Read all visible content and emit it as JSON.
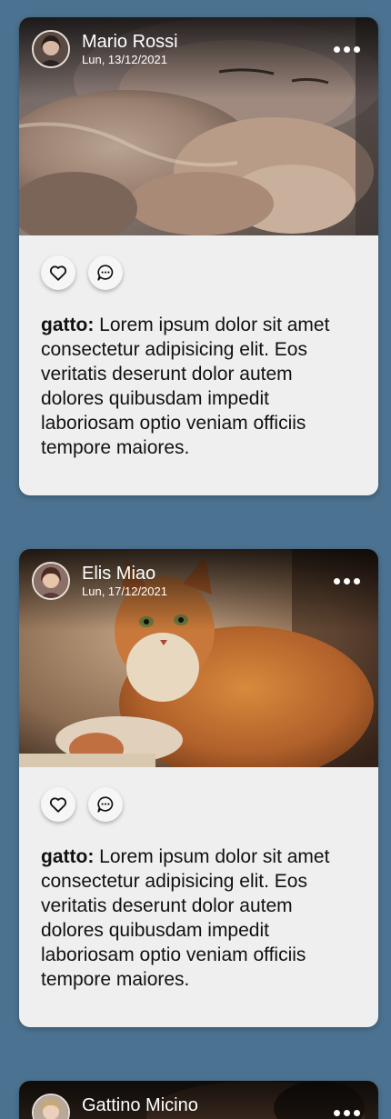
{
  "posts": [
    {
      "author": "Mario Rossi",
      "date": "Lun, 13/12/2021",
      "tag": "gatto:",
      "text": "Lorem ipsum dolor sit amet consectetur adipisicing elit. Eos veritatis deserunt dolor autem dolores quibusdam impedit laboriosam optio veniam officiis tempore maiores."
    },
    {
      "author": "Elis Miao",
      "date": "Lun, 17/12/2021",
      "tag": "gatto:",
      "text": "Lorem ipsum dolor sit amet consectetur adipisicing elit. Eos veritatis deserunt dolor autem dolores quibusdam impedit laboriosam optio veniam officiis tempore maiores."
    },
    {
      "author": "Gattino Micino"
    }
  ],
  "colors": {
    "background": "#4b7290",
    "card": "#efefef"
  }
}
